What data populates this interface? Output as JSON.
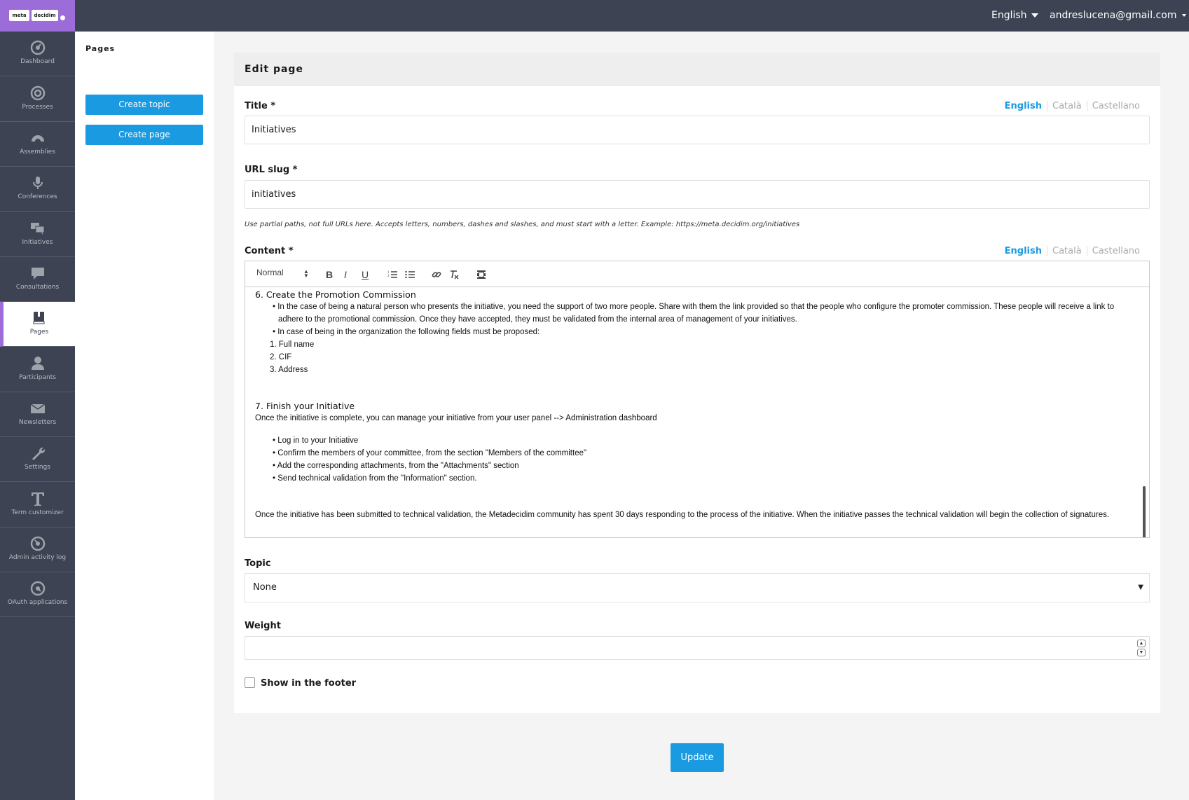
{
  "topbar": {
    "logo_left": "meta",
    "logo_right": "decidim",
    "language": "English",
    "user_email": "andreslucena@gmail.com"
  },
  "sidebar": {
    "items": [
      {
        "label": "Dashboard",
        "icon": "dashboard-icon"
      },
      {
        "label": "Processes",
        "icon": "processes-icon"
      },
      {
        "label": "Assemblies",
        "icon": "assemblies-icon"
      },
      {
        "label": "Conferences",
        "icon": "microphone-icon"
      },
      {
        "label": "Initiatives",
        "icon": "chat-bubbles-icon"
      },
      {
        "label": "Consultations",
        "icon": "speech-bubble-icon"
      },
      {
        "label": "Pages",
        "icon": "book-icon"
      },
      {
        "label": "Participants",
        "icon": "person-icon"
      },
      {
        "label": "Newsletters",
        "icon": "envelope-icon"
      },
      {
        "label": "Settings",
        "icon": "wrench-icon"
      },
      {
        "label": "Term customizer",
        "icon": "text-t-icon"
      },
      {
        "label": "Admin activity log",
        "icon": "activity-log-icon"
      },
      {
        "label": "OAuth applications",
        "icon": "oauth-icon"
      }
    ],
    "active": "Pages"
  },
  "subpanel": {
    "title": "Pages",
    "create_topic": "Create topic",
    "create_page": "Create page"
  },
  "form": {
    "heading": "Edit page",
    "languages": [
      "English",
      "Català",
      "Castellano"
    ],
    "title_label": "Title *",
    "title_value": "Initiatives",
    "slug_label": "URL slug *",
    "slug_value": "initiatives",
    "slug_help": "Use partial paths, not full URLs here. Accepts letters, numbers, dashes and slashes, and must start with a letter. Example: https://meta.decidim.org/initiatives",
    "content_label": "Content *",
    "editor_format": "Normal",
    "content": {
      "h6": "6. Create the Promotion Commission",
      "b1_line1": "• In the case of being a natural person who presents the initiative, you need the support of two more people. Share with them the link provided so that the people who configure the promoter commission. These people will receive a link to",
      "b1_line2": "adhere to the promotional commission. Once they have accepted, they must be validated from the internal area of management of your initiatives.",
      "b2": "• In case of being in the organization the following fields must be proposed:",
      "o1": "1. Full name",
      "o2": "2. CIF",
      "o3": "3. Address",
      "h7": "7. Finish your Initiative",
      "p7": "Once the initiative is complete, you can manage your initiative from your user panel --> Administration dashboard",
      "c1": "• Log in to your Initiative",
      "c2": "• Confirm the members of your committee, from the section \"Members of the committee\"",
      "c3": "• Add the corresponding attachments, from the \"Attachments\" section",
      "c4": "• Send technical validation from the \"Information\" section.",
      "final": "Once the initiative has been submitted to technical validation, the Metadecidim community has spent 30 days responding to the process of the initiative. When the initiative passes the technical validation will begin the collection of signatures."
    },
    "topic_label": "Topic",
    "topic_value": "None",
    "weight_label": "Weight",
    "weight_value": "",
    "footer_label": "Show in the footer",
    "update_label": "Update"
  },
  "colors": {
    "topbar": "#3d4353",
    "logo_bg": "#9c6cd8",
    "primary": "#1a9ae0"
  }
}
